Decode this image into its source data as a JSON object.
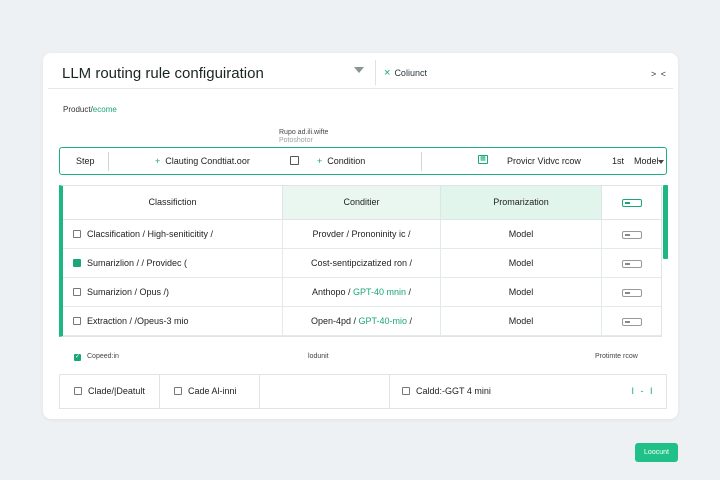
{
  "header": {
    "title": "LLM routing rule configuiration",
    "cancel_label": "Coliunct",
    "collapse_label": "> <"
  },
  "breadcrumb": {
    "prefix": "Product/",
    "current": "ecome"
  },
  "hint": {
    "line1": "Rupo ad.ili.wifte",
    "line2": "Potoshotor"
  },
  "stepbar": {
    "step_label": "Step",
    "add_condition_1": "Clauting Condtiat.oor",
    "add_condition_2": "Condition",
    "provider_label": "Provicr Vidvc rcow",
    "first_label": "1st",
    "model_select": "Model"
  },
  "table": {
    "headers": [
      "Classifiction",
      "Conditier",
      "Promarization"
    ],
    "rows": [
      {
        "checked": false,
        "rule": "Clacsification  /  High-seniticitity  /",
        "condition": "Provder  /  Prononinity ic  /",
        "condition_accent": "",
        "condition_tail": "",
        "model": "Model"
      },
      {
        "checked": true,
        "rule": "Sumarizlion / / Providec (",
        "condition": "Cost-sentipcizatized ron  /",
        "condition_accent": "",
        "condition_tail": "",
        "model": "Model"
      },
      {
        "checked": false,
        "rule": "Sumarizion  /  Opus  /)",
        "condition": "Anthopo  /",
        "condition_accent": "GPT-40 mnin",
        "condition_tail": "/",
        "model": "Model"
      },
      {
        "checked": false,
        "rule": "Extraction  /  /Opeus-3 mio",
        "condition": "Open-4pd  /",
        "condition_accent": "GPT-40-mio",
        "condition_tail": "/",
        "model": "Model"
      }
    ]
  },
  "footer_labels": {
    "copied": "Copeed:in",
    "load": "lodunit",
    "promote": "Protimte rcow"
  },
  "footer": {
    "cell1": "Clade/|Deatult",
    "cell2": "Cade Al-inni",
    "cell4": "Caldd:-GGT 4 mini",
    "cell5": "I - I"
  },
  "submit_label": "Loocunt",
  "colors": {
    "accent": "#19a777",
    "accent_fill": "#1fc188",
    "header_tint": "#e2f5ed"
  }
}
